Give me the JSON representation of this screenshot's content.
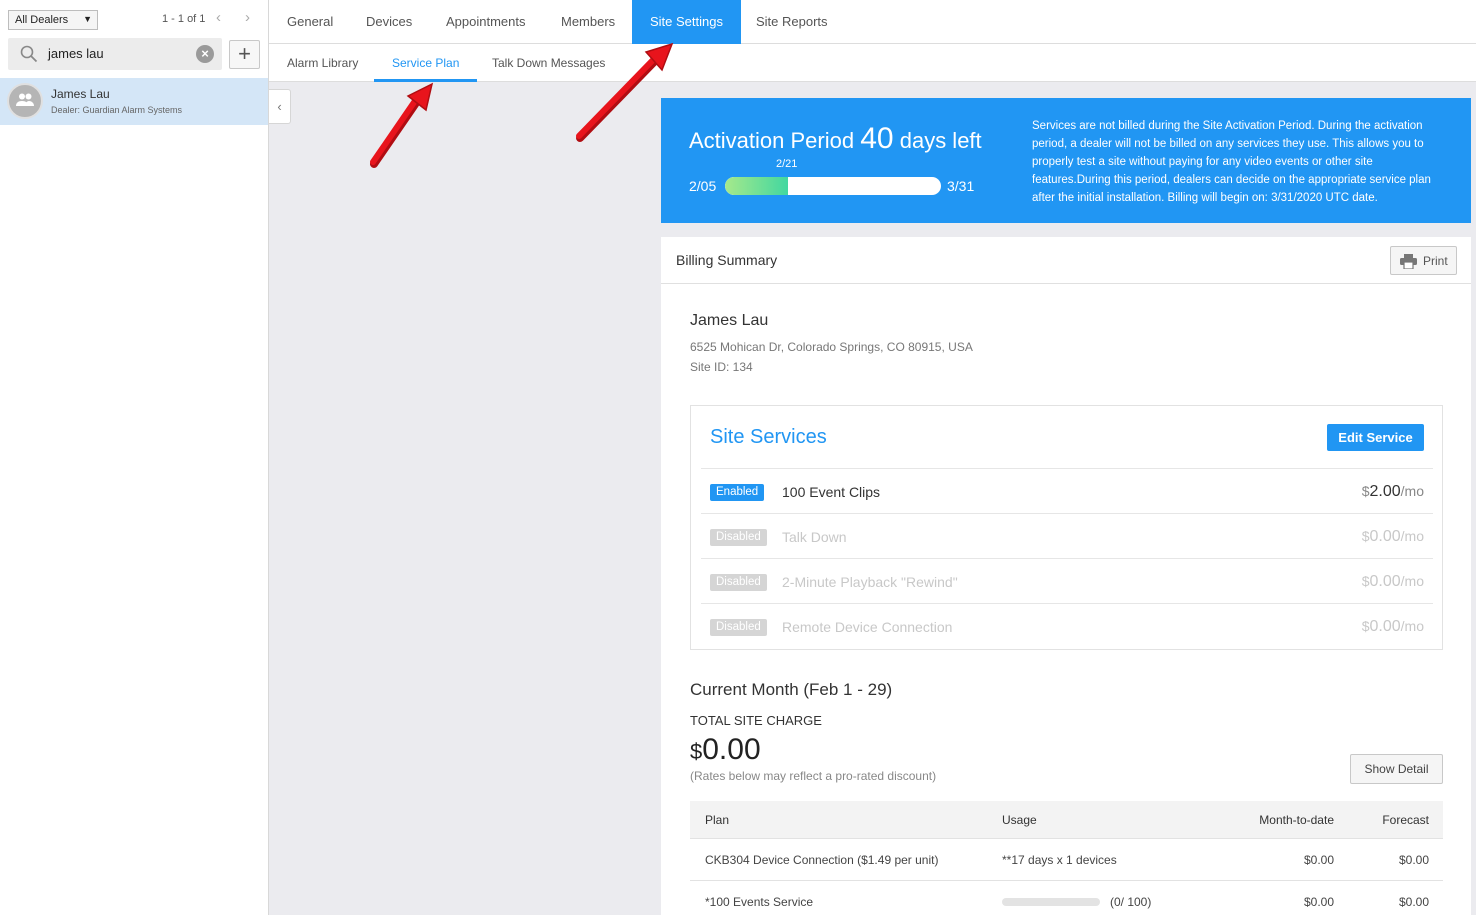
{
  "sidebar": {
    "dealer_filter": "All Dealers",
    "pager": "1 - 1 of 1",
    "search_value": "james lau",
    "user": {
      "name": "James Lau",
      "dealer": "Dealer: Guardian Alarm Systems"
    }
  },
  "top_tabs": [
    "General",
    "Devices",
    "Appointments",
    "Members",
    "Site Settings",
    "Site Reports"
  ],
  "top_tab_active": "Site Settings",
  "sub_tabs": [
    "Alarm Library",
    "Service Plan",
    "Talk Down Messages"
  ],
  "sub_tab_active": "Service Plan",
  "activation": {
    "title_prefix": "Activation Period",
    "days": "40",
    "title_suffix": "days left",
    "start": "2/05",
    "current": "2/21",
    "end": "3/31",
    "progress_fraction": 0.29,
    "description": "Services are not billed during the Site Activation Period. During the activation period, a dealer will not be billed on any services they use. This allows you to properly test a site without paying for any video events or other site features.During this period, dealers can decide on the appropriate service plan after the initial installation. Billing will begin on: 3/31/2020 UTC date."
  },
  "billing": {
    "title": "Billing Summary",
    "print_label": "Print",
    "customer_name": "James Lau",
    "address": "6525 Mohican Dr, Colorado Springs, CO 80915, USA",
    "site_id": "Site ID: 134"
  },
  "site_services": {
    "title": "Site Services",
    "edit_label": "Edit Service",
    "items": [
      {
        "status": "Enabled",
        "name": "100 Event Clips",
        "currency": "$",
        "amount": "2.00",
        "unit": "/mo"
      },
      {
        "status": "Disabled",
        "name": "Talk Down",
        "currency": "$",
        "amount": "0.00",
        "unit": "/mo"
      },
      {
        "status": "Disabled",
        "name": "2-Minute Playback \"Rewind\"",
        "currency": "$",
        "amount": "0.00",
        "unit": "/mo"
      },
      {
        "status": "Disabled",
        "name": "Remote Device Connection",
        "currency": "$",
        "amount": "0.00",
        "unit": "/mo"
      }
    ]
  },
  "current_month": {
    "title": "Current Month (Feb 1 - 29)",
    "total_label": "TOTAL SITE CHARGE",
    "currency": "$",
    "total": "0.00",
    "note": "(Rates below may reflect a pro-rated discount)",
    "detail_label": "Show Detail"
  },
  "plan_table": {
    "headers": [
      "Plan",
      "Usage",
      "Month-to-date",
      "Forecast"
    ],
    "rows": [
      {
        "plan": "CKB304 Device Connection ($1.49 per unit)",
        "usage": "**17 days x 1 devices",
        "mtd": "$0.00",
        "forecast": "$0.00"
      },
      {
        "plan": "*100 Events Service",
        "usage": "(0/ 100)",
        "usage_fraction": 0,
        "mtd": "$0.00",
        "forecast": "$0.00"
      }
    ]
  },
  "colors": {
    "accent": "#2196f3",
    "arrow": "#e8141c",
    "selected_row": "#d4e6f7"
  }
}
